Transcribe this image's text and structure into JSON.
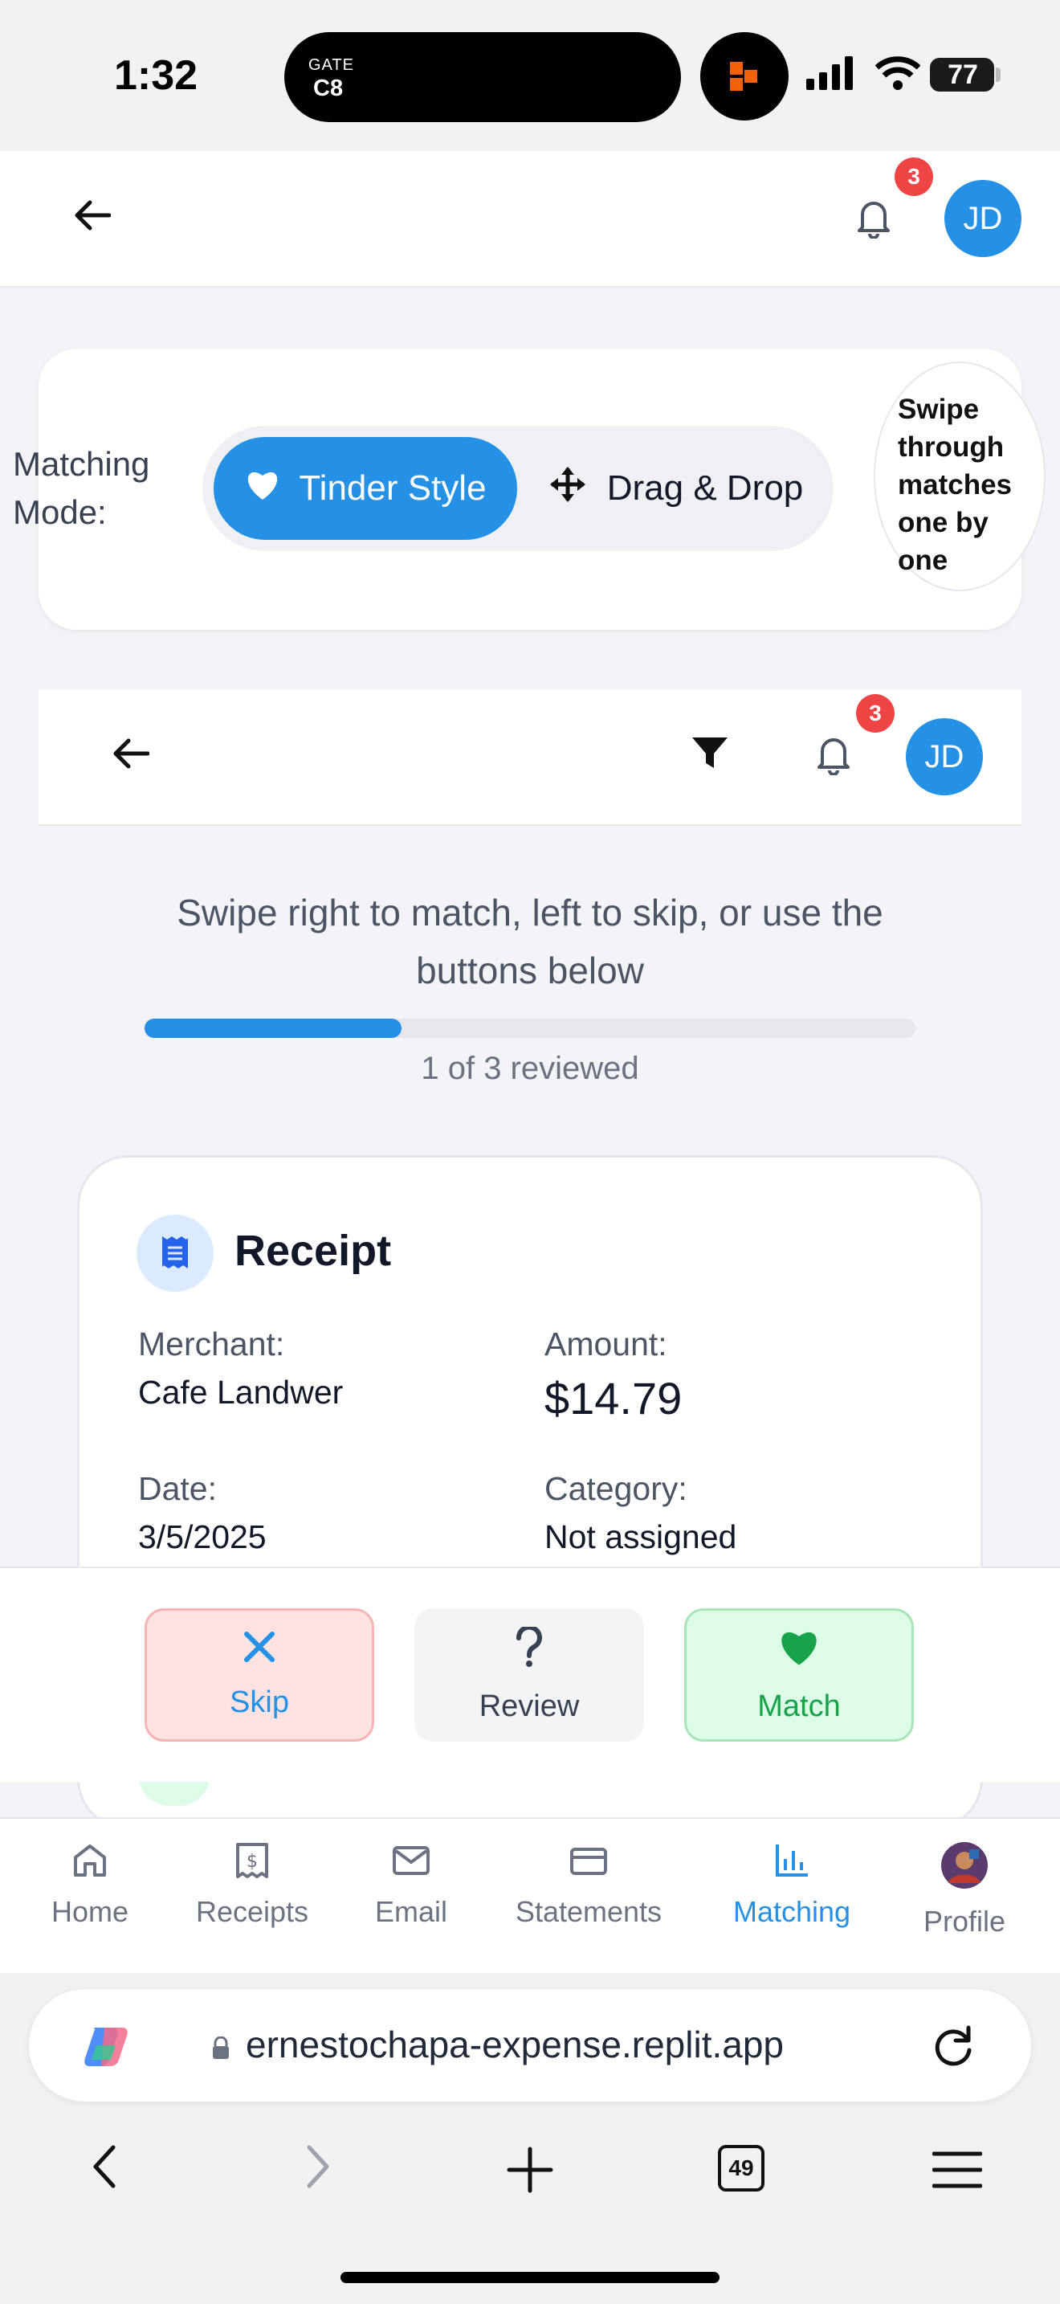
{
  "status_bar": {
    "time": "1:32",
    "live_activity_label": "GATE",
    "live_activity_value": "C8",
    "battery": "77"
  },
  "header": {
    "notification_count": "3",
    "avatar_initials": "JD"
  },
  "matching_mode": {
    "label": "Matching Mode:",
    "options": [
      {
        "label": "Tinder Style",
        "icon": "heart-icon",
        "selected": true
      },
      {
        "label": "Drag & Drop",
        "icon": "move-icon",
        "selected": false
      }
    ],
    "tooltip": "Swipe through matches one by one"
  },
  "inner_header": {
    "notification_count": "3",
    "avatar_initials": "JD"
  },
  "review": {
    "instruction": "Swipe right to match, left to skip, or use the buttons below",
    "progress_fraction": 0.333,
    "progress_text": "1 of 3 reviewed"
  },
  "receipt": {
    "title": "Receipt",
    "merchant_label": "Merchant:",
    "merchant": "Cafe Landwer",
    "amount_label": "Amount:",
    "amount": "$14.79",
    "date_label": "Date:",
    "date": "3/5/2025",
    "category_label": "Category:",
    "category": "Not assigned"
  },
  "actions": {
    "skip": "Skip",
    "review": "Review",
    "match": "Match"
  },
  "bottom_nav": [
    {
      "label": "Home",
      "icon": "home-icon",
      "active": false
    },
    {
      "label": "Receipts",
      "icon": "receipt-icon",
      "active": false
    },
    {
      "label": "Email",
      "icon": "mail-icon",
      "active": false
    },
    {
      "label": "Statements",
      "icon": "card-icon",
      "active": false
    },
    {
      "label": "Matching",
      "icon": "chart-icon",
      "active": true
    },
    {
      "label": "Profile",
      "icon": "profile-avatar",
      "active": false
    }
  ],
  "browser": {
    "url": "ernestochapa-expense.replit.app",
    "tab_count": "49"
  },
  "colors": {
    "accent": "#2490e6",
    "badge": "#ef4444",
    "match": "#16a34a",
    "skip_bg": "#fde2e2"
  }
}
